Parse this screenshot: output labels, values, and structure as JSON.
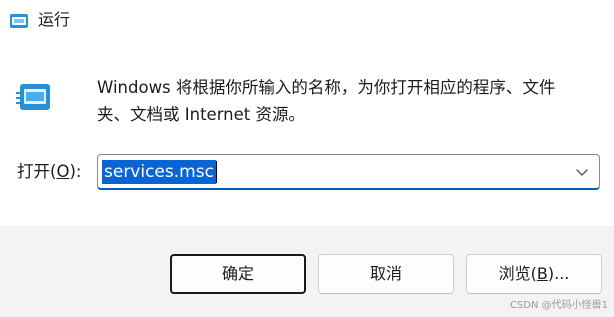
{
  "window": {
    "title": "运行",
    "icon": "run-icon"
  },
  "description": "Windows 将根据你所输入的名称，为你打开相应的程序、文件夹、文档或 Internet 资源。",
  "open": {
    "label_prefix": "打开(",
    "label_hotkey": "O",
    "label_suffix": "):",
    "value": "services.msc",
    "dropdown_icon": "chevron-down-icon"
  },
  "buttons": {
    "ok": "确定",
    "cancel": "取消",
    "browse_prefix": "浏览(",
    "browse_hotkey": "B",
    "browse_suffix": ")..."
  },
  "watermark": "CSDN @代码小怪兽1",
  "colors": {
    "selection": "#0a64d2",
    "focus_border": "#005fb8",
    "icon_blue": "#2b8fd6"
  }
}
